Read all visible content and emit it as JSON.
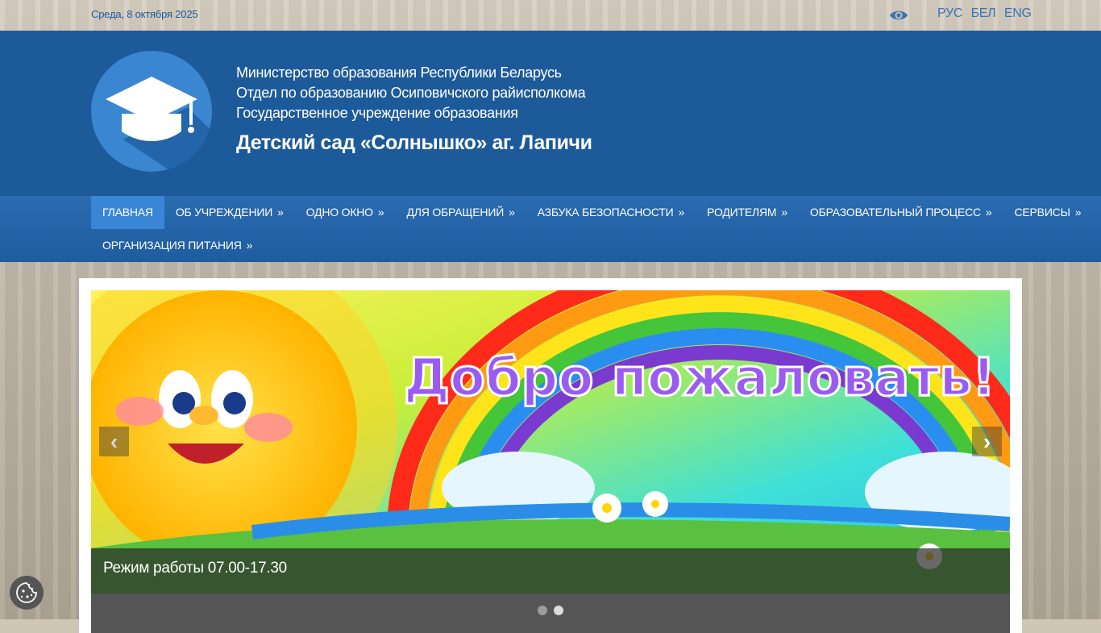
{
  "topbar": {
    "date": "Среда, 8 октября 2025",
    "accessibility_icon": "eye-icon",
    "languages": [
      "РУС",
      "БЕЛ",
      "ENG"
    ]
  },
  "header": {
    "line1": "Министерство образования Республики Беларусь",
    "line2": "Отдел по образованию Осиповичского райисполкома",
    "line3": "Государственное учреждение образования",
    "title": "Детский сад «Солнышко» аг. Лапичи",
    "logo_icon": "graduation-cap-icon"
  },
  "nav": {
    "row1": [
      {
        "label": "ГЛАВНАЯ",
        "arrow": ""
      },
      {
        "label": "ОБ УЧРЕЖДЕНИИ",
        "arrow": "»"
      },
      {
        "label": "ОДНО ОКНО",
        "arrow": "»"
      },
      {
        "label": "ДЛЯ ОБРАЩЕНИЙ",
        "arrow": "»"
      },
      {
        "label": "АЗБУКА БЕЗОПАСНОСТИ",
        "arrow": "»"
      },
      {
        "label": "РОДИТЕЛЯМ",
        "arrow": "»"
      },
      {
        "label": "ОБРАЗОВАТЕЛЬНЫЙ ПРОЦЕСС",
        "arrow": "»"
      },
      {
        "label": "СЕРВИСЫ",
        "arrow": "»"
      }
    ],
    "row2": [
      {
        "label": "ОРГАНИЗАЦИЯ ПИТАНИЯ",
        "arrow": "»"
      }
    ]
  },
  "slider": {
    "banner_text": "Добро пожаловать!",
    "caption": "Режим работы 07.00-17.30",
    "prev": "‹",
    "next": "›",
    "slide_count": 2,
    "active_slide": 1
  },
  "cookie": {
    "icon": "cookie-icon"
  },
  "colors": {
    "header": "#1d5a99",
    "nav": "#2a6bb0",
    "nav_active": "#3a86d6"
  }
}
